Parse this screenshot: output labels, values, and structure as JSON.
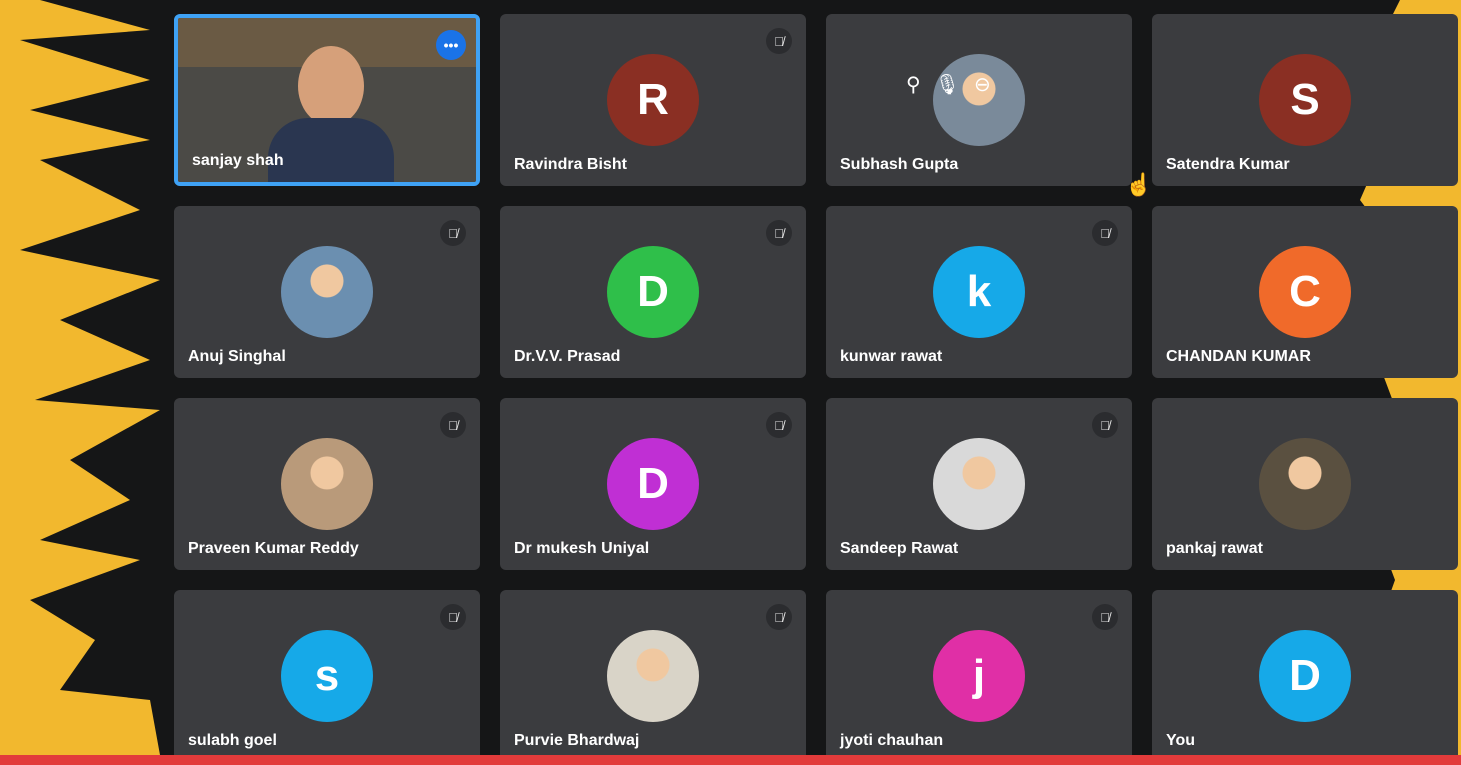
{
  "participants": [
    {
      "name": "sanjay shah",
      "initial": "",
      "color": "#56514b",
      "muted": false,
      "active": true
    },
    {
      "name": "Ravindra Bisht",
      "initial": "R",
      "color": "#8a2f23",
      "muted": true
    },
    {
      "name": "Subhash Gupta",
      "initial": "",
      "color": "#7a8a9a",
      "muted": false,
      "hover": true
    },
    {
      "name": "Satendra Kumar",
      "initial": "S",
      "color": "#8a2f23",
      "muted": false
    },
    {
      "name": "Anuj Singhal",
      "initial": "",
      "color": "#6b8fb0",
      "muted": true
    },
    {
      "name": "Dr.V.V. Prasad",
      "initial": "D",
      "color": "#2fbf4a",
      "muted": true
    },
    {
      "name": "kunwar rawat",
      "initial": "k",
      "color": "#16a9e8",
      "muted": true
    },
    {
      "name": "CHANDAN KUMAR",
      "initial": "C",
      "color": "#f06a2a",
      "muted": false
    },
    {
      "name": "Praveen Kumar Reddy",
      "initial": "",
      "color": "#b99a7a",
      "muted": true
    },
    {
      "name": "Dr mukesh Uniyal",
      "initial": "D",
      "color": "#c02fd4",
      "muted": true
    },
    {
      "name": "Sandeep Rawat",
      "initial": "",
      "color": "#d9d9d9",
      "muted": true
    },
    {
      "name": "pankaj rawat",
      "initial": "",
      "color": "#5a5040",
      "muted": false
    },
    {
      "name": "sulabh goel",
      "initial": "s",
      "color": "#16a9e8",
      "muted": true
    },
    {
      "name": "Purvie Bhardwaj",
      "initial": "",
      "color": "#d9d4c8",
      "muted": true
    },
    {
      "name": "jyoti chauhan",
      "initial": "j",
      "color": "#e02fa6",
      "muted": true
    },
    {
      "name": "You",
      "initial": "D",
      "color": "#16a9e8",
      "muted": false
    }
  ],
  "icons": {
    "mute": "mic-off-icon",
    "more": "more-options-icon"
  },
  "hover_controls": [
    "pin-icon",
    "mic-icon",
    "remove-icon"
  ],
  "colors": {
    "background": "#f2b82e",
    "tile": "#3b3c3f",
    "active_border": "#3fa2f5",
    "bottom_bar": "#e23b3b"
  }
}
